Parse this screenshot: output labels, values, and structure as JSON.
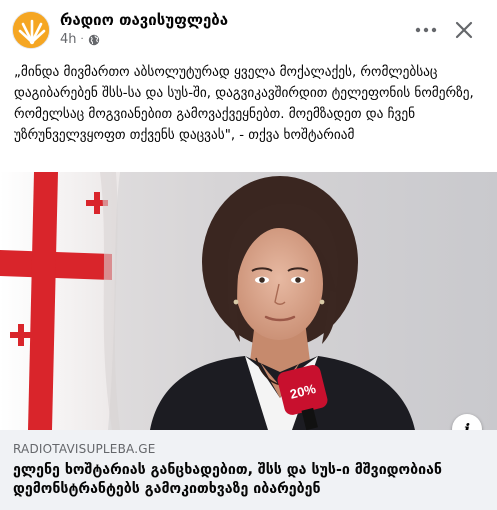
{
  "header": {
    "page_name": "რადიო თავისუფლება",
    "time_ago": "4h",
    "separator": "·",
    "avatar_icon": "radio-liberty-logo-icon",
    "audience_icon": "globe-icon",
    "more_icon": "more-dots-icon",
    "close_icon": "close-icon"
  },
  "post": {
    "text": "„მინდა მივმართო აბსოლუტურად ყველა მოქალაქეს, რომლებსაც დაგიბარებენ შსს-სა და სუს-ში, დაგვიკავშირდით ტელეფონის ნომერზე, რომელსაც მოგვიანებით გამოვაქვეყნებთ. მოემზადეთ და ჩვენ უზრუნველვყოფთ თქვენს დაცვას\", - თქვა ხოშტარიამ"
  },
  "media": {
    "microphone_label": "20%",
    "info_label": "i"
  },
  "link_preview": {
    "domain": "RADIOTAVISUPLEBA.GE",
    "title": "ელენე ხოშტარიას განცხადებით, შსს და სუს-ი მშვიდობიან დემონსტრანტებს გამოკითხვაზე იბარებენ"
  },
  "colors": {
    "brand": "#f5a623",
    "link_preview_bg": "#f0f2f5",
    "flag_red": "#d9252b",
    "mic_red": "#c8102e",
    "secondary_text": "#65676b"
  }
}
